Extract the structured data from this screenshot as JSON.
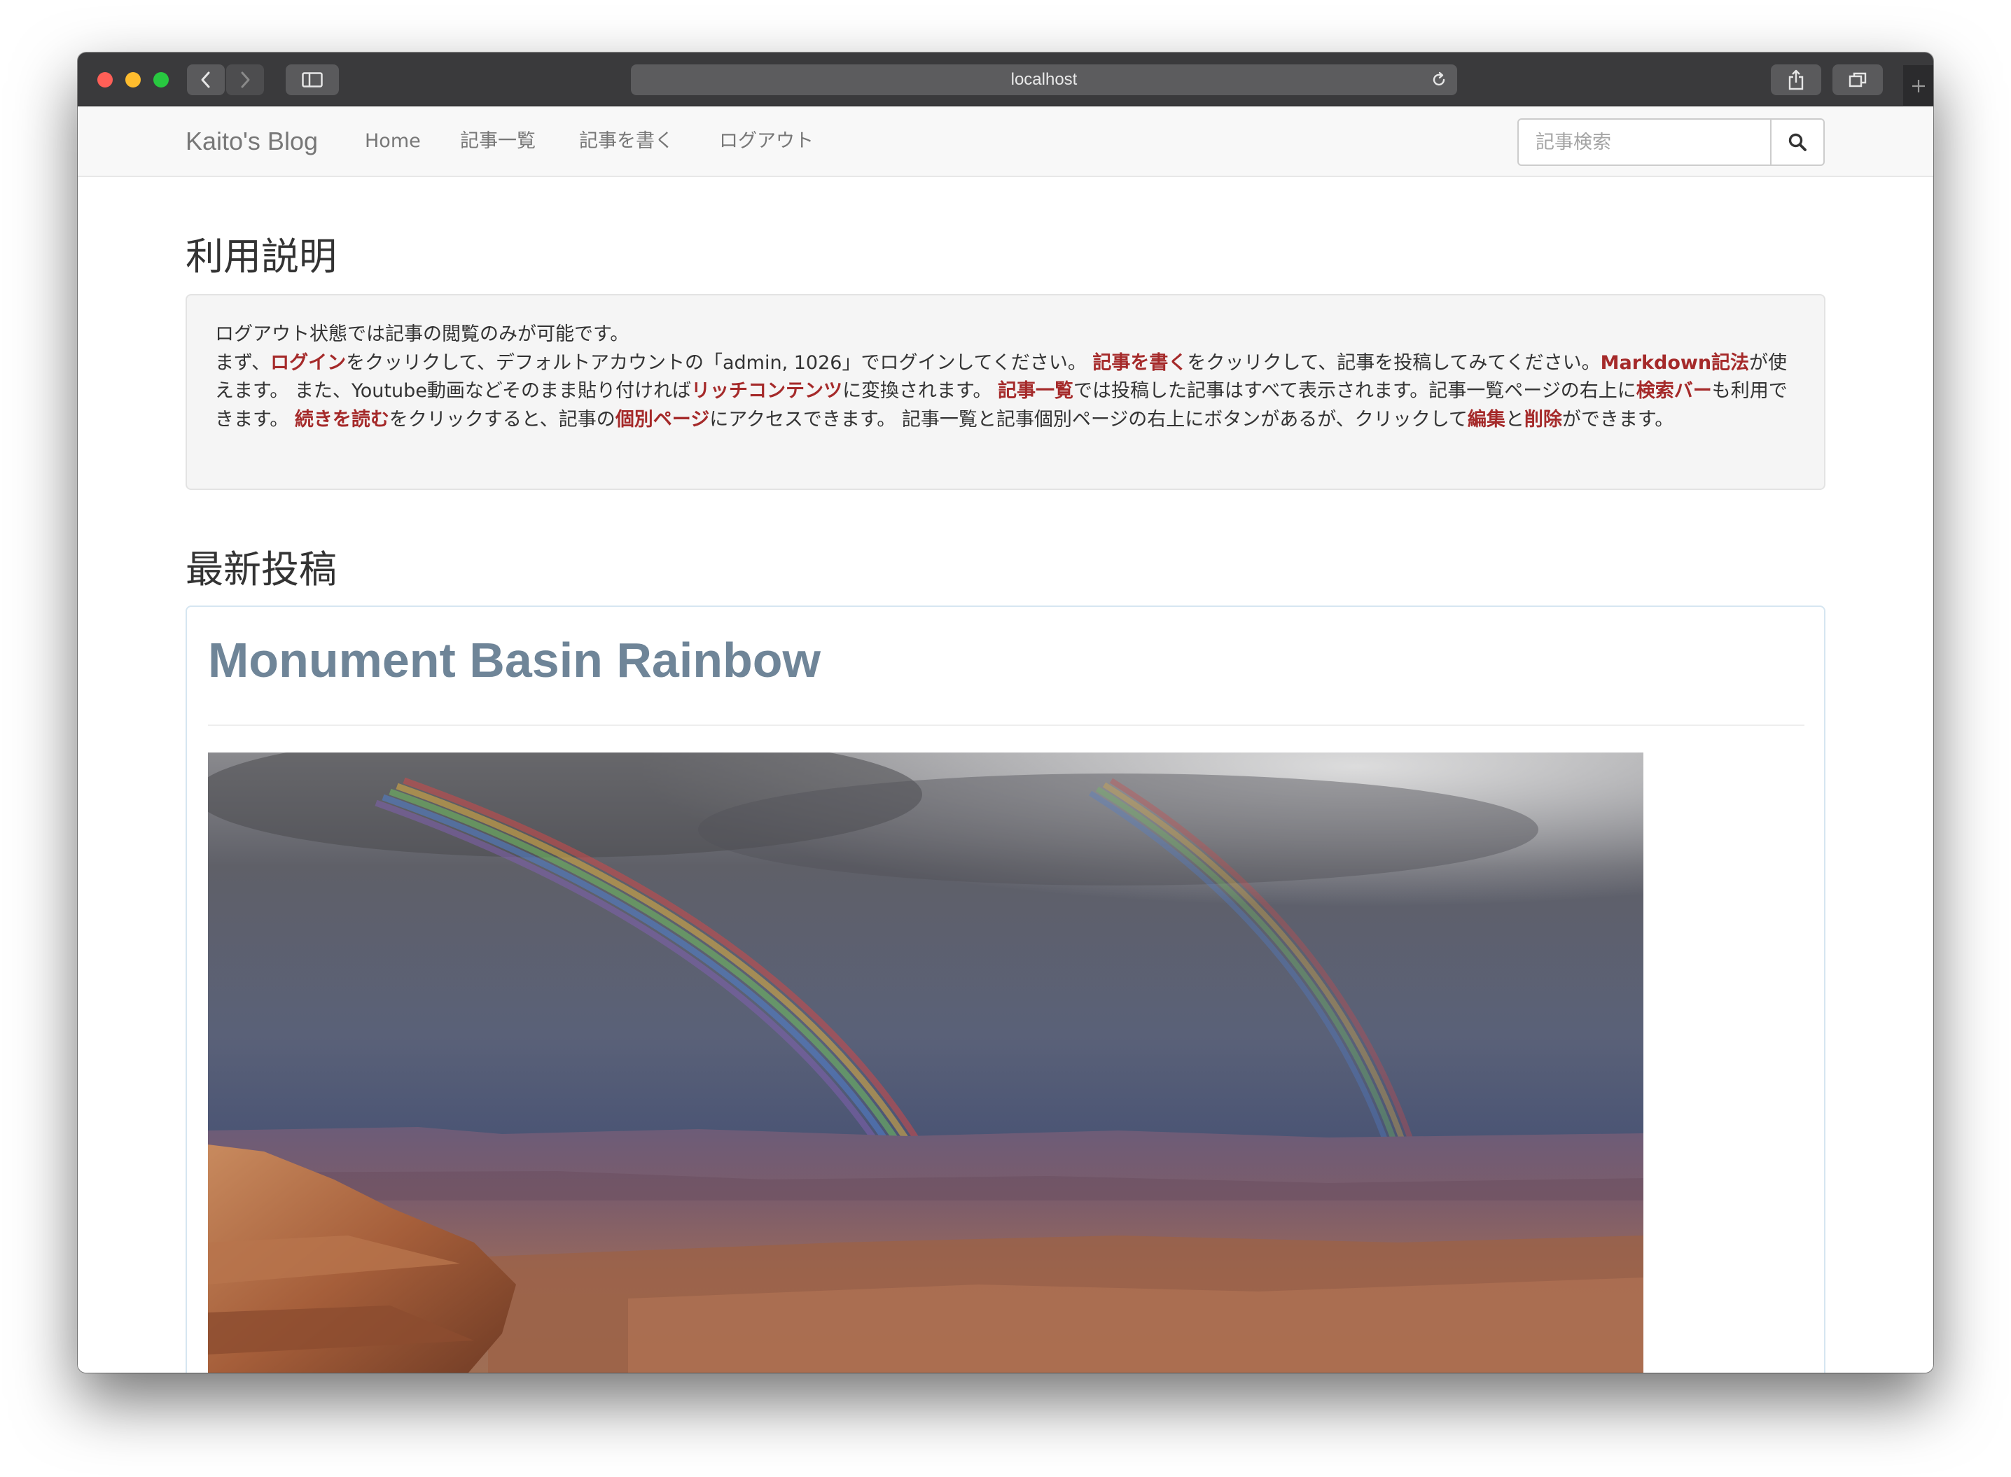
{
  "browser": {
    "url": "localhost",
    "icons": {
      "back": "chevron-left-icon",
      "forward": "chevron-right-icon",
      "sidebar": "sidebar-icon",
      "reload": "reload-icon",
      "share": "share-icon",
      "tabs": "tabs-icon",
      "new_tab": "plus-icon"
    }
  },
  "navbar": {
    "brand": "Kaito's Blog",
    "items": [
      "Home",
      "記事一覧",
      "記事を書く",
      "ログアウト"
    ],
    "search_placeholder": "記事検索",
    "search_icon": "search-icon"
  },
  "usage": {
    "heading": "利用説明",
    "line1": "ログアウト状態では記事の閲覧のみが可能です。",
    "p1": "まず、",
    "link_login": "ログイン",
    "p2": "をクッリクして、デフォルトアカウントの「admin, 1026」でログインしてください。 ",
    "link_write": "記事を書く",
    "p3": "をクッリクして、記事を投稿してみてください。",
    "link_markdown": "Markdown記法",
    "p4": "が使えます。 また、Youtube動画などそのまま貼り付ければ",
    "link_rich": "リッチコンテンツ",
    "p5": "に変換されます。 ",
    "link_list": "記事一覧",
    "p6": "では投稿した記事はすべて表示されます。記事一覧ページの右上に",
    "link_search": "検索バー",
    "p7": "も利用できます。 ",
    "link_more": "続きを読む",
    "p8": "をクリックすると、記事の",
    "link_page": "個別ページ",
    "p9": "にアクセスできます。 記事一覧と記事個別ページの右上にボタンがあるが、クリックして",
    "link_edit": "編集",
    "p10": "と",
    "link_delete": "削除",
    "p11": "ができます。"
  },
  "latest": {
    "heading": "最新投稿",
    "post_title": "Monument Basin Rainbow"
  },
  "colors": {
    "link": "#a52a2a",
    "post_title": "#6f8598",
    "navbar_bg": "#f8f8f8",
    "well_bg": "#f5f5f5"
  }
}
